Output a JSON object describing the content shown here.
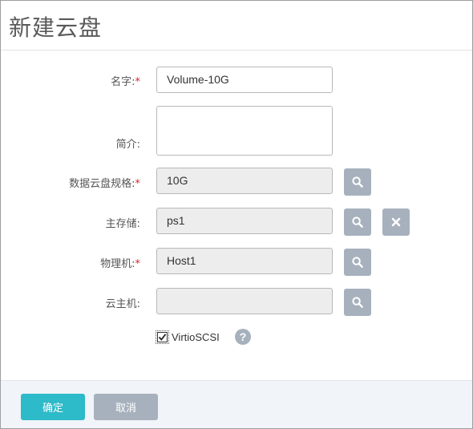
{
  "dialog": {
    "title": "新建云盘"
  },
  "form": {
    "name": {
      "label": "名字:",
      "required_mark": "*",
      "value": "Volume-10G"
    },
    "description": {
      "label": "简介:",
      "value": ""
    },
    "disk_offering": {
      "label": "数据云盘规格:",
      "required_mark": "*",
      "value": "10G"
    },
    "primary_storage": {
      "label": "主存储:",
      "value": "ps1"
    },
    "host": {
      "label": "物理机:",
      "required_mark": "*",
      "value": "Host1"
    },
    "vm_instance": {
      "label": "云主机:",
      "value": ""
    },
    "virtio_scsi": {
      "label": "VirtioSCSI",
      "checked": true,
      "help_glyph": "?"
    }
  },
  "footer": {
    "ok_label": "确定",
    "cancel_label": "取消"
  },
  "icons": {
    "search": "search-icon",
    "clear": "close-icon",
    "help": "help-icon"
  },
  "colors": {
    "primary": "#2dbac9",
    "icon_button": "#a7b1bd",
    "required": "#d9232d"
  }
}
